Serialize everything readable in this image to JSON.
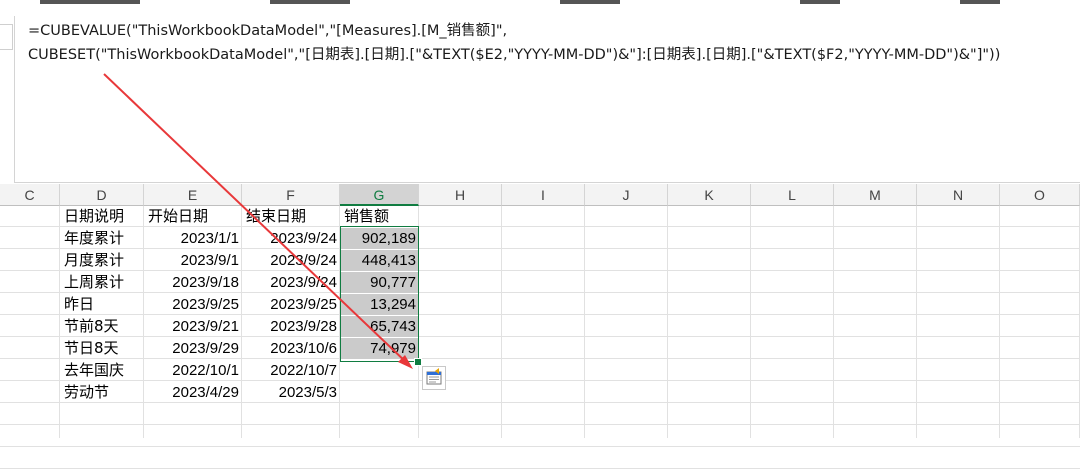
{
  "formula": {
    "line1": "=CUBEVALUE(\"ThisWorkbookDataModel\",\"[Measures].[M_销售额]\",",
    "line2": "CUBESET(\"ThisWorkbookDataModel\",\"[日期表].[日期].[\"&TEXT($E2,\"YYYY-MM-DD\")&\"]:[日期表].[日期].[\"&TEXT($F2,\"YYYY-MM-DD\")&\"]\"))"
  },
  "columns": [
    "C",
    "D",
    "E",
    "F",
    "G",
    "H",
    "I",
    "J",
    "K",
    "L",
    "M",
    "N",
    "O"
  ],
  "selected_column": "G",
  "table": {
    "headers": [
      "日期说明",
      "开始日期",
      "结束日期",
      "销售额"
    ],
    "rows": [
      {
        "label": "年度累计",
        "start": "2023/1/1",
        "end": "2023/9/24",
        "sales": "902,189"
      },
      {
        "label": "月度累计",
        "start": "2023/9/1",
        "end": "2023/9/24",
        "sales": "448,413"
      },
      {
        "label": "上周累计",
        "start": "2023/9/18",
        "end": "2023/9/24",
        "sales": "90,777"
      },
      {
        "label": "昨日",
        "start": "2023/9/25",
        "end": "2023/9/25",
        "sales": "13,294"
      },
      {
        "label": "节前8天",
        "start": "2023/9/21",
        "end": "2023/9/28",
        "sales": "65,743"
      },
      {
        "label": "节日8天",
        "start": "2023/9/29",
        "end": "2023/10/6",
        "sales": "74,979"
      },
      {
        "label": "去年国庆",
        "start": "2022/10/1",
        "end": "2022/10/7",
        "sales": ""
      },
      {
        "label": "劳动节",
        "start": "2023/4/29",
        "end": "2023/5/3",
        "sales": ""
      }
    ]
  },
  "colors": {
    "accent": "#107c41",
    "arrow": "#e8383a",
    "selection": "#cbcbcb"
  },
  "icons": {
    "quick_analysis": "quick-analysis-icon",
    "annotation": "red-arrow-icon"
  }
}
